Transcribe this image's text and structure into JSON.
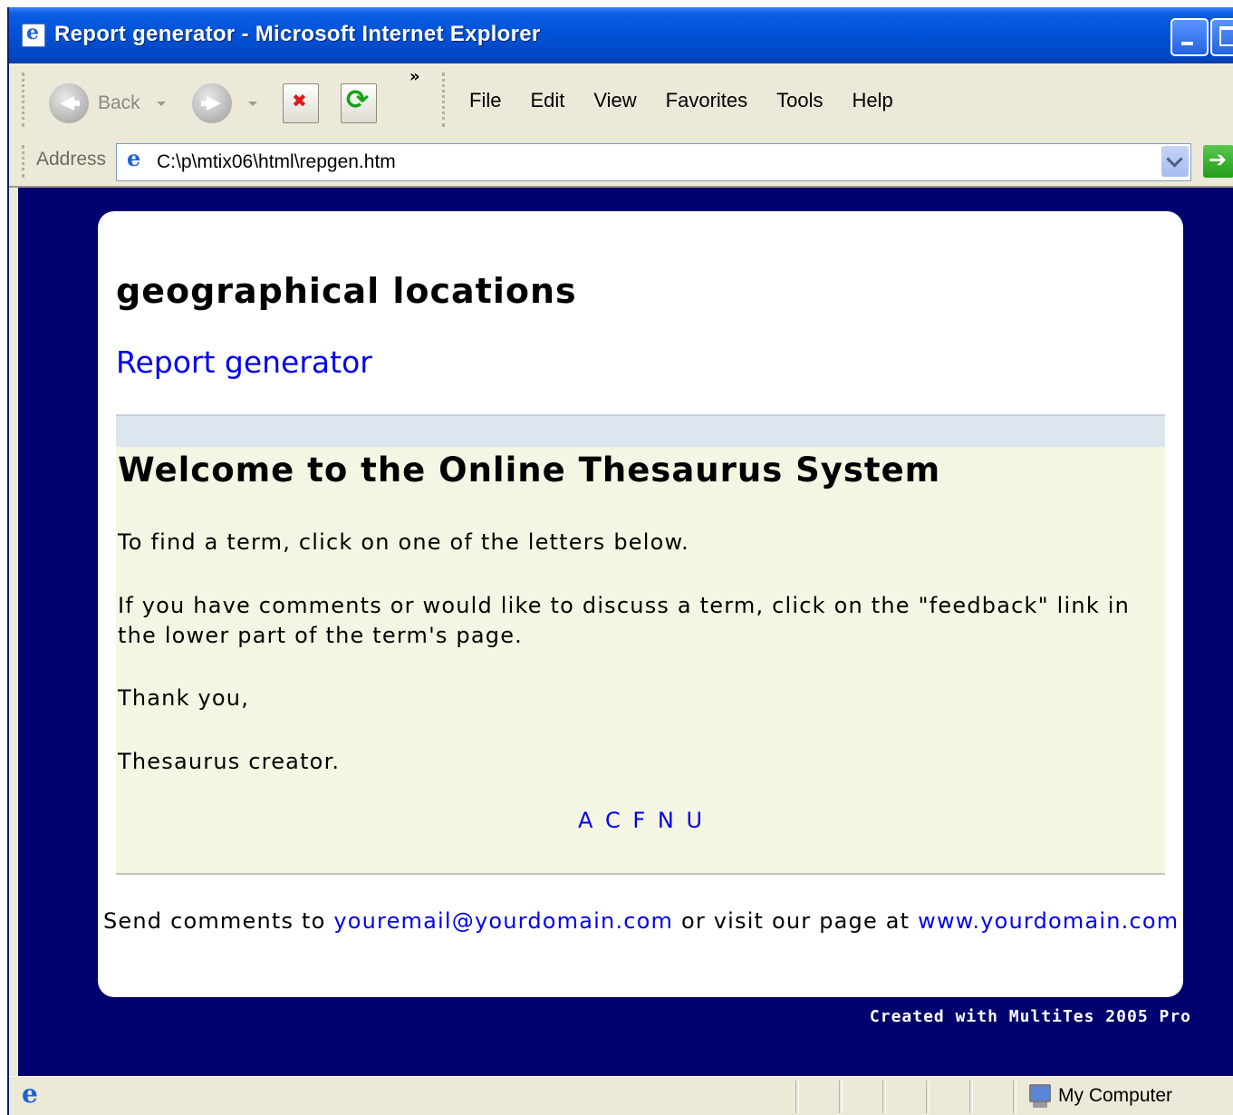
{
  "window": {
    "title": "Report generator - Microsoft Internet Explorer"
  },
  "toolbar": {
    "back_label": "Back",
    "chevron": "»",
    "menu": [
      "File",
      "Edit",
      "View",
      "Favorites",
      "Tools",
      "Help"
    ]
  },
  "address": {
    "label": "Address",
    "url": "C:\\p\\mtix06\\html\\repgen.htm"
  },
  "page": {
    "heading": "geographical locations",
    "report_link": "Report generator",
    "welcome_title": "Welcome to the Online Thesaurus System",
    "paragraphs": [
      "To find a term, click on one of the letters below.",
      "If you have comments or would like to discuss a term, click on the \"feedback\" link in the lower part of the term's page.",
      "Thank you,",
      "Thesaurus creator."
    ],
    "letters": [
      "A",
      "C",
      "F",
      "N",
      "U"
    ],
    "footer": {
      "prefix": "Send comments to ",
      "email": "youremail@yourdomain.com",
      "middle": " or visit our page at ",
      "website": "www.yourdomain.com"
    },
    "created_with": "Created with MultiTes 2005 Pro"
  },
  "status": {
    "zone": "My Computer"
  },
  "colors": {
    "page_background": "#00006e",
    "panel_background": "#f5f5e3",
    "link": "#0000ee"
  }
}
